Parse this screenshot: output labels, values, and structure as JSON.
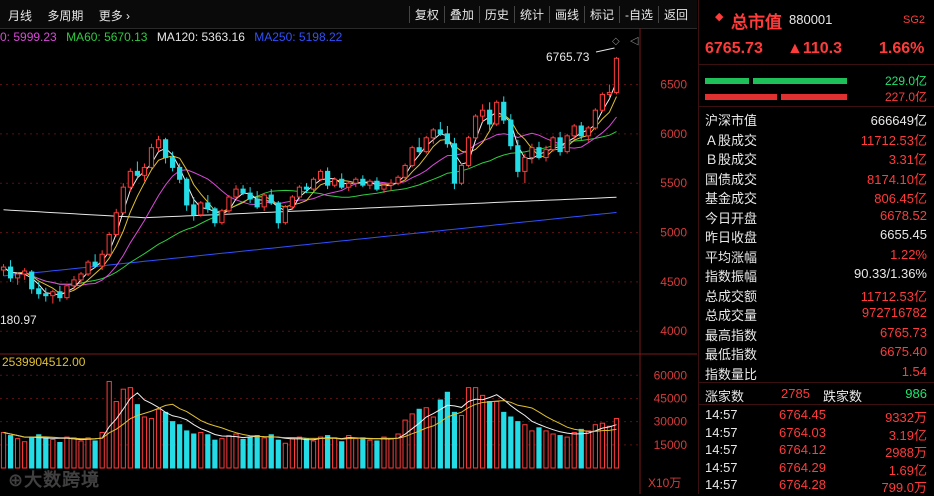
{
  "toolbar": {
    "left": [
      "月线",
      "多周期",
      "更多 ›"
    ],
    "right": [
      "复权",
      "叠加",
      "历史",
      "统计",
      "画线",
      "标记",
      "-自选",
      "返回"
    ]
  },
  "ma": [
    {
      "label": "0: 5999.23",
      "color": "#d84ad8"
    },
    {
      "label": "MA60: 5670.13",
      "color": "#2ecc40"
    },
    {
      "label": "MA120: 5363.16",
      "color": "#e6e6e6"
    },
    {
      "label": "MA250: 5198.22",
      "color": "#3050ff"
    }
  ],
  "chart_labels": {
    "high_value": "6765.73",
    "low_value": "180.97",
    "volume_label": "2539904512.00",
    "volume_unit": "X10万"
  },
  "colors": {
    "up": "#ff3b3b",
    "down": "#23dce6",
    "ma_short": "#f0f0f0",
    "ma_mid": "#e0c030",
    "ma60": "#2ecc40",
    "ma_purple": "#d84ad8",
    "ma120": "#e6e6e6",
    "ma250": "#3050ff"
  },
  "price_ticks": [
    "6500",
    "6000",
    "5500",
    "5000",
    "4500",
    "4000"
  ],
  "volume_ticks": [
    "60000",
    "45000",
    "30000",
    "15000"
  ],
  "panel": {
    "title": "总市值",
    "code": "880001",
    "badge": "SG2",
    "price": "6765.73",
    "change": "▲110.3",
    "change_pct": "1.66%",
    "bar1_value": "229.0亿",
    "bar2_value": "227.0亿",
    "stats": [
      {
        "k": "沪深市值",
        "v": "666649亿",
        "c": "white"
      },
      {
        "k": "Ａ股成交",
        "v": "11712.53亿",
        "c": "red"
      },
      {
        "k": "Ｂ股成交",
        "v": "3.31亿",
        "c": "red"
      },
      {
        "k": "国债成交",
        "v": "8174.10亿",
        "c": "red"
      },
      {
        "k": "基金成交",
        "v": "806.45亿",
        "c": "red"
      },
      {
        "k": "今日开盘",
        "v": "6678.52",
        "c": "red"
      },
      {
        "k": "昨日收盘",
        "v": "6655.45",
        "c": "white"
      },
      {
        "k": "平均涨幅",
        "v": "1.22%",
        "c": "red"
      },
      {
        "k": "指数振幅",
        "v": "90.33/1.36%",
        "c": "white"
      },
      {
        "k": "总成交额",
        "v": "11712.53亿",
        "c": "red"
      },
      {
        "k": "总成交量",
        "v": "972716782",
        "c": "red"
      },
      {
        "k": "最高指数",
        "v": "6765.73",
        "c": "red"
      },
      {
        "k": "最低指数",
        "v": "6675.40",
        "c": "red"
      },
      {
        "k": "指数量比",
        "v": "1.54",
        "c": "red"
      }
    ],
    "rise_label": "涨家数",
    "rise_count": "2785",
    "fall_label": "跌家数",
    "fall_count": "986",
    "ticks": [
      {
        "time": "14:57",
        "price": "6764.45",
        "vol": "9332万"
      },
      {
        "time": "14:57",
        "price": "6764.03",
        "vol": "3.19亿"
      },
      {
        "time": "14:57",
        "price": "6764.12",
        "vol": "2988万"
      },
      {
        "time": "14:57",
        "price": "6764.29",
        "vol": "1.69亿"
      },
      {
        "time": "14:57",
        "price": "6764.28",
        "vol": "799.0万"
      }
    ]
  },
  "chart_data": {
    "type": "candlestick",
    "ylim": [
      3850,
      6850
    ],
    "vol_ylim": [
      0,
      66000
    ],
    "candles": [
      [
        4620,
        4680,
        4560,
        4650
      ],
      [
        4650,
        4720,
        4500,
        4540
      ],
      [
        4540,
        4600,
        4470,
        4580
      ],
      [
        4580,
        4640,
        4520,
        4610
      ],
      [
        4600,
        4620,
        4380,
        4430
      ],
      [
        4430,
        4500,
        4330,
        4380
      ],
      [
        4380,
        4440,
        4300,
        4360
      ],
      [
        4360,
        4420,
        4280,
        4400
      ],
      [
        4400,
        4460,
        4300,
        4340
      ],
      [
        4340,
        4480,
        4320,
        4460
      ],
      [
        4460,
        4560,
        4420,
        4520
      ],
      [
        4520,
        4600,
        4480,
        4580
      ],
      [
        4580,
        4720,
        4560,
        4700
      ],
      [
        4700,
        4780,
        4640,
        4660
      ],
      [
        4660,
        4820,
        4620,
        4780
      ],
      [
        4780,
        5000,
        4760,
        4980
      ],
      [
        4980,
        5240,
        4960,
        5200
      ],
      [
        5200,
        5500,
        5180,
        5460
      ],
      [
        5460,
        5650,
        5420,
        5620
      ],
      [
        5620,
        5720,
        5540,
        5580
      ],
      [
        5580,
        5700,
        5520,
        5660
      ],
      [
        5660,
        5900,
        5640,
        5860
      ],
      [
        5860,
        5980,
        5820,
        5940
      ],
      [
        5940,
        5960,
        5700,
        5760
      ],
      [
        5760,
        5820,
        5620,
        5660
      ],
      [
        5660,
        5700,
        5500,
        5540
      ],
      [
        5540,
        5560,
        5220,
        5280
      ],
      [
        5280,
        5360,
        5120,
        5180
      ],
      [
        5180,
        5320,
        5160,
        5300
      ],
      [
        5300,
        5380,
        5200,
        5240
      ],
      [
        5240,
        5260,
        5060,
        5100
      ],
      [
        5100,
        5240,
        5080,
        5220
      ],
      [
        5220,
        5380,
        5200,
        5360
      ],
      [
        5360,
        5480,
        5340,
        5440
      ],
      [
        5440,
        5480,
        5380,
        5400
      ],
      [
        5400,
        5460,
        5300,
        5340
      ],
      [
        5340,
        5420,
        5240,
        5260
      ],
      [
        5260,
        5400,
        5220,
        5380
      ],
      [
        5380,
        5440,
        5280,
        5300
      ],
      [
        5300,
        5320,
        5040,
        5100
      ],
      [
        5100,
        5280,
        5080,
        5260
      ],
      [
        5260,
        5380,
        5240,
        5360
      ],
      [
        5360,
        5480,
        5340,
        5460
      ],
      [
        5460,
        5500,
        5400,
        5440
      ],
      [
        5440,
        5560,
        5420,
        5540
      ],
      [
        5540,
        5640,
        5520,
        5620
      ],
      [
        5620,
        5660,
        5440,
        5480
      ],
      [
        5480,
        5560,
        5460,
        5540
      ],
      [
        5540,
        5600,
        5440,
        5460
      ],
      [
        5460,
        5520,
        5420,
        5500
      ],
      [
        5500,
        5560,
        5460,
        5540
      ],
      [
        5540,
        5580,
        5460,
        5480
      ],
      [
        5480,
        5540,
        5440,
        5520
      ],
      [
        5520,
        5560,
        5420,
        5440
      ],
      [
        5440,
        5500,
        5400,
        5480
      ],
      [
        5480,
        5540,
        5420,
        5500
      ],
      [
        5500,
        5580,
        5480,
        5560
      ],
      [
        5560,
        5700,
        5540,
        5680
      ],
      [
        5680,
        5880,
        5660,
        5860
      ],
      [
        5860,
        5960,
        5800,
        5820
      ],
      [
        5820,
        5980,
        5800,
        5960
      ],
      [
        5960,
        6060,
        5900,
        6040
      ],
      [
        6040,
        6120,
        5980,
        6000
      ],
      [
        6000,
        6080,
        5860,
        5900
      ],
      [
        5900,
        5960,
        5440,
        5500
      ],
      [
        5500,
        5700,
        5480,
        5680
      ],
      [
        5680,
        5980,
        5660,
        5960
      ],
      [
        5960,
        6200,
        5940,
        6180
      ],
      [
        6180,
        6300,
        6120,
        6240
      ],
      [
        6240,
        6320,
        6040,
        6100
      ],
      [
        6100,
        6340,
        6080,
        6320
      ],
      [
        6320,
        6380,
        6100,
        6140
      ],
      [
        6140,
        6200,
        5840,
        5880
      ],
      [
        5880,
        5940,
        5560,
        5620
      ],
      [
        5620,
        5800,
        5500,
        5760
      ],
      [
        5760,
        5900,
        5700,
        5860
      ],
      [
        5860,
        5920,
        5740,
        5760
      ],
      [
        5760,
        5880,
        5720,
        5840
      ],
      [
        5840,
        5980,
        5820,
        5960
      ],
      [
        5960,
        6020,
        5780,
        5820
      ],
      [
        5820,
        6000,
        5800,
        5980
      ],
      [
        5980,
        6100,
        5940,
        6080
      ],
      [
        6080,
        6120,
        5940,
        5980
      ],
      [
        5980,
        6080,
        5920,
        6060
      ],
      [
        6060,
        6260,
        6040,
        6240
      ],
      [
        6240,
        6420,
        6220,
        6400
      ],
      [
        6400,
        6500,
        6360,
        6420
      ],
      [
        6420,
        6780,
        6400,
        6766
      ]
    ],
    "volumes": [
      23000,
      21000,
      19000,
      17000,
      20000,
      21500,
      19500,
      18500,
      16500,
      20000,
      19500,
      17500,
      19500,
      17500,
      23000,
      56000,
      43000,
      51000,
      52000,
      41000,
      33000,
      32000,
      38000,
      36000,
      30000,
      28000,
      24000,
      22000,
      23000,
      21500,
      18000,
      19000,
      21000,
      22000,
      18500,
      20000,
      21000,
      19500,
      21500,
      18000,
      16000,
      19000,
      20000,
      19000,
      17500,
      20000,
      21000,
      19500,
      17000,
      21000,
      19000,
      19500,
      18000,
      17500,
      20000,
      19000,
      22000,
      31000,
      35000,
      38000,
      39000,
      33000,
      44000,
      49000,
      36000,
      34000,
      52000,
      52000,
      47000,
      43000,
      43000,
      36000,
      33000,
      30000,
      28000,
      24000,
      26000,
      24000,
      22000,
      21000,
      20000,
      23000,
      25000,
      24000,
      28000,
      29000,
      27000,
      32000
    ]
  }
}
